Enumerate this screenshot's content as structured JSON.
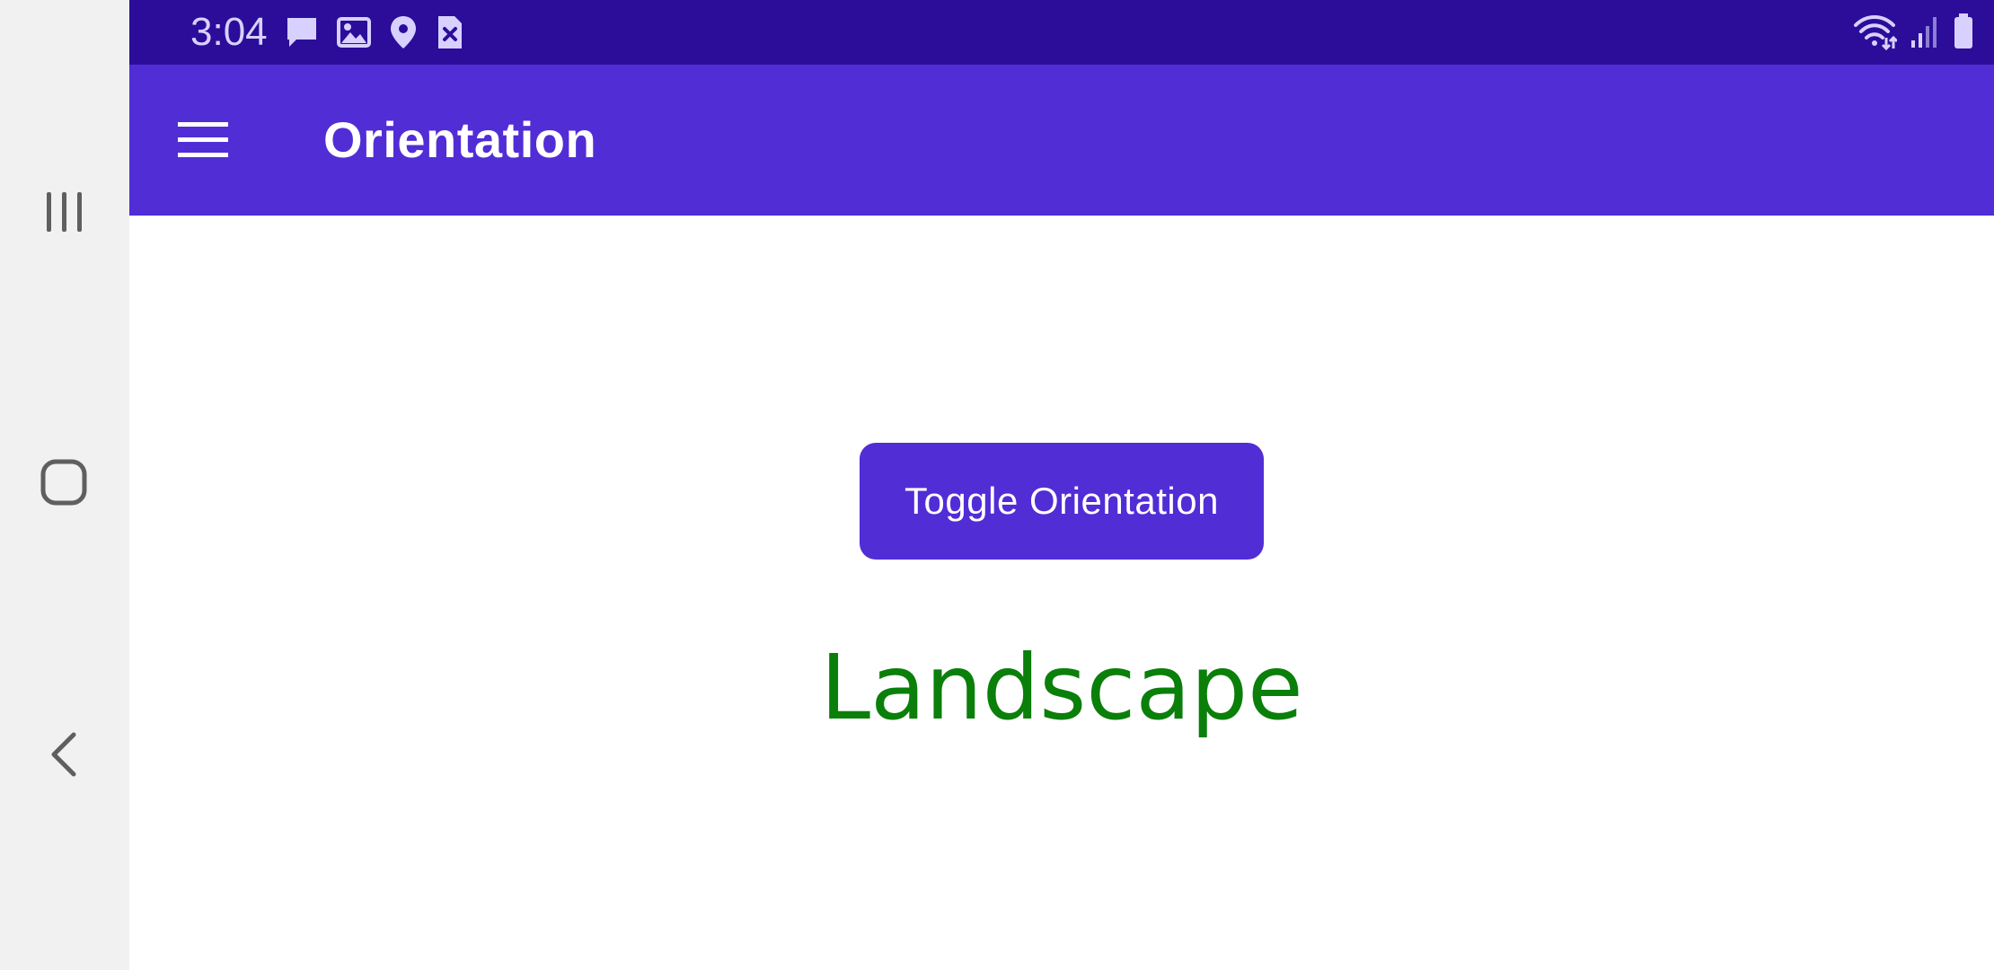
{
  "status_bar": {
    "time": "3:04",
    "left_icons": [
      "message-icon",
      "image-icon",
      "location-icon",
      "sim-card-icon"
    ],
    "right_icons": [
      "wifi-icon",
      "signal-icon",
      "battery-icon"
    ]
  },
  "app_bar": {
    "title": "Orientation",
    "menu_icon": "hamburger-menu-icon"
  },
  "main": {
    "toggle_button_label": "Toggle Orientation",
    "orientation_text": "Landscape"
  },
  "navigation_bar": {
    "items": [
      "recent-apps-icon",
      "home-icon",
      "back-icon"
    ]
  },
  "colors": {
    "status_bar": "#2b0d9a",
    "app_bar": "#512dd6",
    "button": "#512dd6",
    "orientation_text": "#0a7f0a",
    "nav_bar": "#f1f1f1"
  }
}
